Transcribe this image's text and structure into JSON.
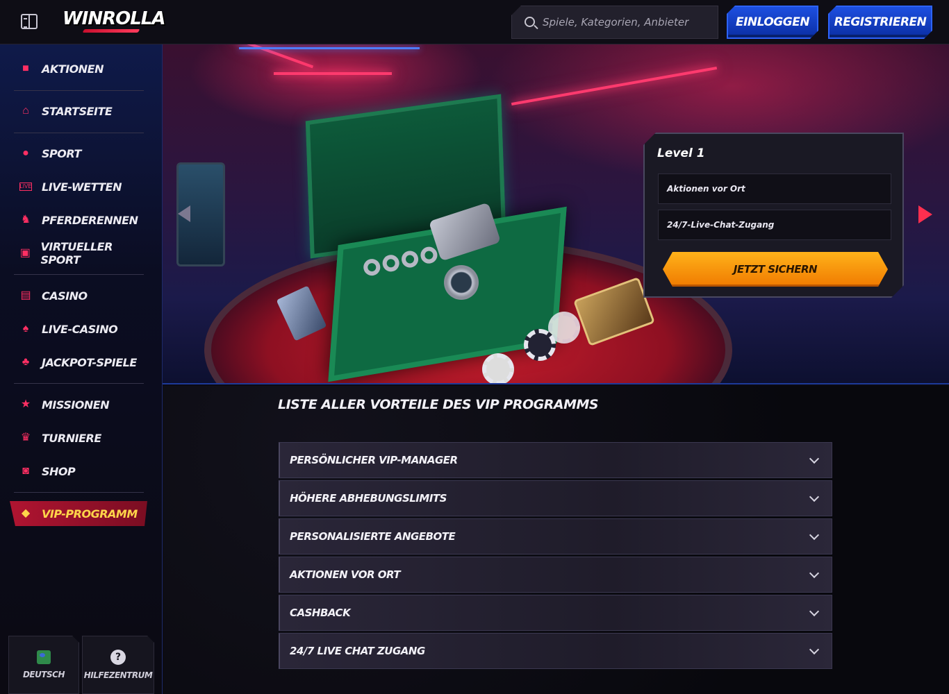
{
  "header": {
    "logo": "WINROLLA",
    "search_placeholder": "Spiele, Kategorien, Anbieter",
    "login_label": "EINLOGGEN",
    "register_label": "REGISTRIEREN"
  },
  "sidebar": {
    "items": [
      {
        "label": "AKTIONEN",
        "icon": "gift-icon"
      },
      {
        "label": "STARTSEITE",
        "icon": "home-icon"
      },
      {
        "label": "SPORT",
        "icon": "basketball-icon"
      },
      {
        "label": "LIVE-WETTEN",
        "icon": "live-icon"
      },
      {
        "label": "PFERDERENNEN",
        "icon": "horse-icon"
      },
      {
        "label": "VIRTUELLER SPORT",
        "icon": "monitor-icon"
      },
      {
        "label": "CASINO",
        "icon": "slot-icon"
      },
      {
        "label": "LIVE-CASINO",
        "icon": "card-icon"
      },
      {
        "label": "JACKPOT-SPIELE",
        "icon": "clover-icon"
      },
      {
        "label": "MISSIONEN",
        "icon": "star-badge-icon"
      },
      {
        "label": "TURNIERE",
        "icon": "trophy-icon"
      },
      {
        "label": "SHOP",
        "icon": "bag-icon"
      },
      {
        "label": "VIP-PROGRAMM",
        "icon": "diamond-icon"
      }
    ],
    "language_label": "DEUTSCH",
    "help_label": "HILFEZENTRUM",
    "help_glyph": "?"
  },
  "level_card": {
    "title": "Level 1",
    "benefits": [
      "Aktionen vor Ort",
      "24/7-Live-Chat-Zugang"
    ],
    "cta_label": "JETZT SICHERN"
  },
  "benefits_section": {
    "title": "LISTE ALLER VORTEILE DES VIP PROGRAMMS",
    "items": [
      "PERSÖNLICHER VIP-MANAGER",
      "HÖHERE ABHEBUNGSLIMITS",
      "PERSONALISIERTE ANGEBOTE",
      "AKTIONEN VOR ORT",
      "CASHBACK",
      "24/7 LIVE CHAT ZUGANG"
    ]
  },
  "colors": {
    "accent_red": "#ff2f63",
    "brand_blue": "#1d4fe0",
    "cta_orange": "#ffb21a",
    "vip_gold": "#ffd54a"
  }
}
